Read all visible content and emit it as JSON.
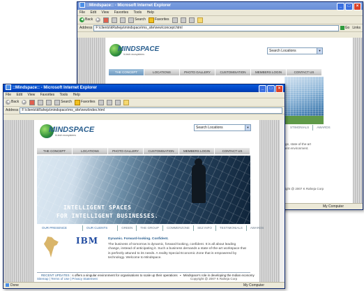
{
  "back_window": {
    "title": "::Mindspace:: - Microsoft Internet Explorer",
    "menu": [
      "File",
      "Edit",
      "View",
      "Favorites",
      "Tools",
      "Help"
    ],
    "toolbar": {
      "back": "Back",
      "search": "Search",
      "favorites": "Favorites"
    },
    "address_label": "Address",
    "address_value": "F:\\clients\\kRaheja\\mindspace\\ms_site\\new\\concept.html",
    "go": "Go",
    "links": "Links",
    "logo_name": "MINDSPACE",
    "logo_tag": "hi-tech ecosystems",
    "search_select": "Search Locations",
    "nav": [
      "THE CONCEPT",
      "LOCATIONS",
      "PHOTO GALLERY",
      "CUSTOMISATION",
      "MEMBERS LOGIN",
      "CONTACT US"
    ],
    "subnav_visible": [
      "STIMONIALS",
      "AWARDS"
    ],
    "text_fragments": [
      "ge, state-of-the-art",
      "ent environment."
    ],
    "copyright_fragment": "ight @ 2007 K Raheja Corp",
    "status_zone": "My Computer"
  },
  "front_window": {
    "title": "::Mindspace:: - Microsoft Internet Explorer",
    "menu": [
      "File",
      "Edit",
      "View",
      "Favorites",
      "Tools",
      "Help"
    ],
    "toolbar": {
      "back": "Back",
      "search": "Search",
      "favorites": "Favorites"
    },
    "address_label": "Address",
    "address_value": "F:\\clients\\kRaheja\\mindspace\\ms_site\\new\\index.html",
    "logo_name": "MINDSPACE",
    "logo_tag": "hi-tech ecosystems",
    "search_select": "Search Locations",
    "nav": [
      "THE CONCEPT",
      "LOCATIONS",
      "PHOTO GALLERY",
      "CUSTOMISATION",
      "MEMBERS LOGIN",
      "CONTACT US"
    ],
    "hero_line1": "INTELLIGENT SPACES",
    "hero_line2": "FOR INTELLIGENT BUSINESSES.",
    "subnav": [
      "OUR PRESENCE",
      "OUR CLIENTS",
      "GREEN",
      "THE GROUP",
      "COMMERZONE",
      "SEZ INFO",
      "TESTIMONIALS",
      "AWARDS"
    ],
    "client_logo": "IBM",
    "intro_heading": "Dynamic. Forward-looking. Confident.",
    "intro_body": "The business of tomorrow is dynamic, forward-looking, confident. It is all about leading change, instead of anticipating it. Such a business demands a state-of-the-art workspace that is perfectly attuned to its needs. A reality Special Economic Zone that is empowered by technology. Welcome to Mindspace.",
    "updates_label": "RECENT UPDATES :",
    "updates_text": "s offers a singular environment for organisations to scale up their operations",
    "updates_text2": "Mindspace's role in developing the Indian economy",
    "footer_links": "Sitemap  |  Terms of Use | Privacy Statement",
    "footer_copy": "Copyright @ 2007 K Raheja Corp",
    "status_left": "Done",
    "status_zone": "My Computer"
  }
}
